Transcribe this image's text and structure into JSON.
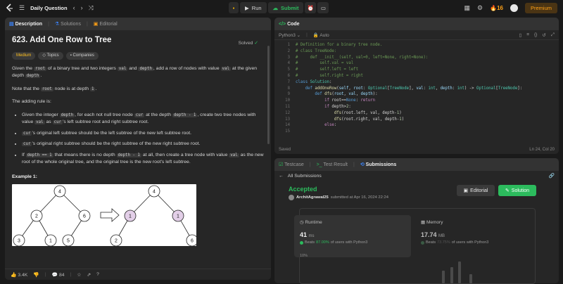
{
  "topbar": {
    "title": "Daily Question",
    "run_label": "Run",
    "submit_label": "Submit",
    "streak": "16",
    "premium_label": "Premium"
  },
  "left_tabs": {
    "description": "Description",
    "solutions": "Solutions",
    "editorial": "Editorial"
  },
  "problem": {
    "title": "623. Add One Row to Tree",
    "status": "Solved",
    "difficulty": "Medium",
    "topics_label": "Topics",
    "companies_label": "Companies",
    "intro_1": "Given the ",
    "intro_root": "root",
    "intro_2": " of a binary tree and two integers ",
    "intro_val": "val",
    "intro_3": " and ",
    "intro_depth": "depth",
    "intro_4": ", add a row of nodes with value ",
    "intro_val2": "val",
    "intro_5": " at the given depth ",
    "intro_depth2": "depth",
    "intro_6": ".",
    "note_1": "Note that the ",
    "note_root": "root",
    "note_2": " node is at depth ",
    "note_one": "1",
    "note_3": ".",
    "rule_intro": "The adding rule is:",
    "r1_a": "Given the integer ",
    "r1_depth": "depth",
    "r1_b": ", for each not null tree node ",
    "r1_cur": "cur",
    "r1_c": " at the depth ",
    "r1_dm1": "depth - 1",
    "r1_d": ", create two tree nodes with value ",
    "r1_val": "val",
    "r1_e": " as ",
    "r1_cur2": "cur",
    "r1_f": "'s left subtree root and right subtree root.",
    "r2_cur": "cur",
    "r2_text": "'s original left subtree should be the left subtree of the new left subtree root.",
    "r3_cur": "cur",
    "r3_text": "'s original right subtree should be the right subtree of the new right subtree root.",
    "r4_a": "If ",
    "r4_dep1": "depth == 1",
    "r4_b": " that means there is no depth ",
    "r4_dm1": "depth - 1",
    "r4_c": " at all, then create a tree node with value ",
    "r4_val": "val",
    "r4_d": " as the new root of the whole original tree, and the original tree is the new root's left subtree.",
    "example_title": "Example 1:",
    "tree_left_nodes": [
      "4",
      "2",
      "6",
      "3",
      "1",
      "5"
    ],
    "tree_right_nodes": [
      "4",
      "1",
      "1",
      "2",
      "6"
    ],
    "likes": "3.4K",
    "comments": "84"
  },
  "code_panel": {
    "tab": "Code",
    "language": "Python3",
    "mode": "Auto",
    "status": "Saved",
    "cursor": "Ln 24, Col 20",
    "lines": [
      {
        "n": "1",
        "html": "<span class='cmt'># Definition for a binary tree node.</span>"
      },
      {
        "n": "2",
        "html": "<span class='cmt'># class TreeNode:</span>"
      },
      {
        "n": "3",
        "html": "<span class='cmt'>#     def __init__(self, val=0, left=None, right=None):</span>"
      },
      {
        "n": "4",
        "html": "<span class='cmt'>#         self.val = val</span>"
      },
      {
        "n": "5",
        "html": "<span class='cmt'>#         self.left = left</span>"
      },
      {
        "n": "6",
        "html": "<span class='cmt'>#         self.right = right</span>"
      },
      {
        "n": "7",
        "html": "<span class='kw'>class</span> <span class='ty'>Solution</span>:"
      },
      {
        "n": "8",
        "html": "    <span class='kw'>def</span> <span class='fn'>addOneRow</span>(<span class='pm'>self</span>, <span class='pm'>root</span>: <span class='ty'>Optional</span>[<span class='ty'>TreeNode</span>], <span class='pm'>val</span>: <span class='ty'>int</span>, <span class='pm'>depth</span>: <span class='ty'>int</span>) -&gt; <span class='ty'>Optional</span>[<span class='ty'>TreeNode</span>]:"
      },
      {
        "n": "9",
        "html": "        <span class='kw'>def</span> <span class='fn'>dfs</span>(<span class='pm'>root</span>, <span class='pm'>val</span>, <span class='pm'>depth</span>):"
      },
      {
        "n": "10",
        "html": "            <span class='kw2'>if</span> root==<span class='kw'>None</span>: <span class='kw2'>return</span>"
      },
      {
        "n": "11",
        "html": "            <span class='kw2'>if</span> depth&gt;<span class='nm'>2</span>:"
      },
      {
        "n": "12",
        "html": "                <span class='fn'>dfs</span>(root.left, val, depth-<span class='nm'>1</span>)"
      },
      {
        "n": "13",
        "html": "                <span class='fn'>dfs</span>(root.right, val, depth-<span class='nm'>1</span>)"
      },
      {
        "n": "14",
        "html": "            <span class='kw2'>else</span>:"
      },
      {
        "n": "15",
        "html": ""
      }
    ]
  },
  "result_panel": {
    "tab_testcase": "Testcase",
    "tab_result": "Test Result",
    "tab_submissions": "Submissions",
    "back_label": "All Submissions",
    "verdict": "Accepted",
    "user": "ArchitAgrawal25",
    "submitted_text": "submitted at Apr 16, 2024 22:24",
    "editorial_label": "Editorial",
    "solution_label": "Solution",
    "runtime_label": "Runtime",
    "runtime_value": "41",
    "runtime_unit": "ms",
    "runtime_beats_a": "Beats",
    "runtime_beats_pct": "87.00%",
    "runtime_beats_b": "of users with Python3",
    "memory_label": "Memory",
    "memory_value": "17.74",
    "memory_unit": "MB",
    "memory_beats_a": "Beats",
    "memory_beats_pct": "73.75%",
    "memory_beats_b": "of users with Python3",
    "histogram_label": "10%"
  },
  "colors": {
    "accent": "#ffa116",
    "green": "#2cbb5d",
    "medium": "#ffc01e",
    "panel": "#262626",
    "bg": "#1a1a1a"
  }
}
